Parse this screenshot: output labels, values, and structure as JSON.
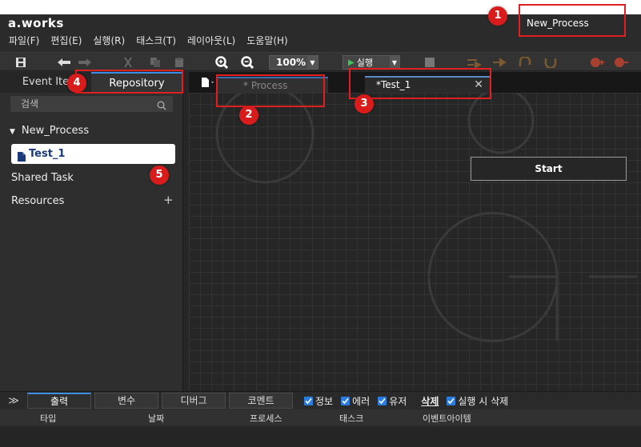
{
  "app": {
    "title": "a.works",
    "process_name": "New_Process"
  },
  "menu": [
    "파일(F)",
    "편집(E)",
    "실행(R)",
    "태스크(T)",
    "레이아웃(L)",
    "도움말(H)"
  ],
  "toolbar": {
    "zoom": "100%",
    "run_label": "실행"
  },
  "left_panel": {
    "tabs": [
      "Event Ite",
      "Repository"
    ],
    "search_placeholder": "검색",
    "tree_root": "New_Process",
    "tree_selected": "Test_1",
    "shared_task": "Shared Task",
    "resources": "Resources",
    "add_symbol": "+"
  },
  "doc_tabs": {
    "process": "* Process",
    "test": "*Test_1",
    "close": "✕"
  },
  "canvas": {
    "start_node": "Start"
  },
  "bottom": {
    "tabs": [
      "출력",
      "변수",
      "디버그",
      "코멘트"
    ],
    "checks": [
      "정보",
      "에러",
      "유저"
    ],
    "delete_label": "삭제",
    "delete_on_run": "실행 시 삭제",
    "columns": [
      "타입",
      "날짜",
      "프로세스",
      "태스크",
      "이벤트아이템"
    ]
  },
  "annotations": [
    "1",
    "2",
    "3",
    "4",
    "5"
  ],
  "colors": {
    "annotation": "#e02020",
    "accent": "#3d8ee6"
  }
}
